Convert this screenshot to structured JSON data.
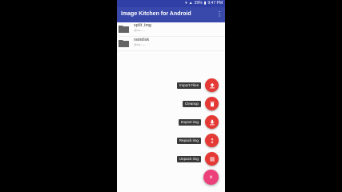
{
  "status_bar": {
    "battery": "29%",
    "time": "9:47 PM"
  },
  "app_bar": {
    "title": "Image Kitchen for Android"
  },
  "files": [
    {
      "name": "split_img",
      "sub": "@rw-----"
    },
    {
      "name": "ramdisk",
      "sub": "@rw-----"
    }
  ],
  "fab_menu": [
    {
      "label": "Import Files",
      "icon": "upload-icon"
    },
    {
      "label": "Cleanup",
      "icon": "delete-icon"
    },
    {
      "label": "Export img",
      "icon": "download-icon"
    },
    {
      "label": "Repack img",
      "icon": "repack-icon"
    },
    {
      "label": "Unpack img",
      "icon": "unpack-icon"
    }
  ],
  "main_fab": {
    "icon": "close-icon",
    "glyph": "×"
  },
  "colors": {
    "primary": "#3949ab",
    "status": "#2f3fa6",
    "fab": "#e53935",
    "main_fab": "#ec407a"
  }
}
